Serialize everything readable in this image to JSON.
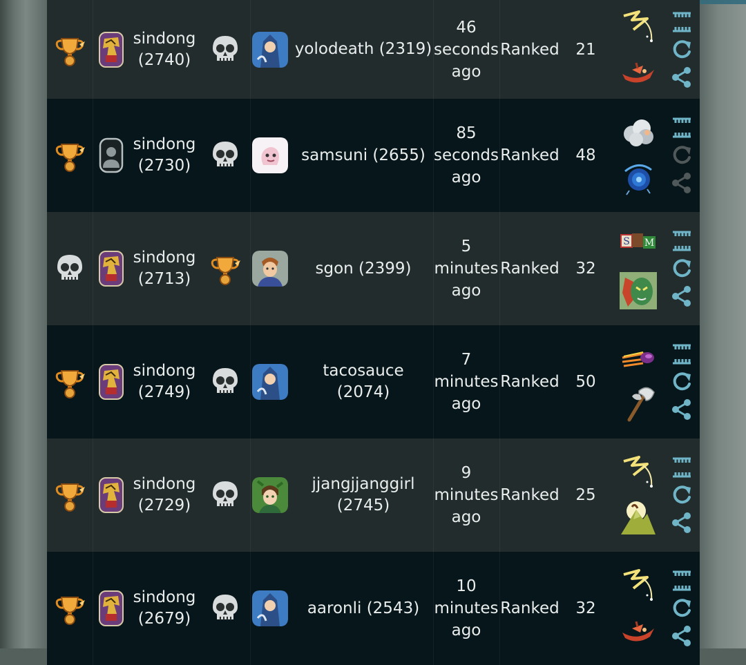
{
  "colors": {
    "row_light": "#222c2d",
    "row_dark": "#07161b",
    "text": "#e9edec",
    "action": "#6fb5c7",
    "action_dim": "#50585a"
  },
  "rows": [
    {
      "p1_result": "trophy-icon",
      "p1_avatar": "armored-knight-avatar",
      "p1_name": "sindong",
      "p1_rating": "(2740)",
      "p2_result": "skull-icon",
      "p2_avatar": "wizard-avatar",
      "p2_name_lines": [
        "yolodeath (2319)"
      ],
      "time_lines": [
        "46",
        "seconds",
        "ago"
      ],
      "type": "Ranked",
      "turns": "21",
      "cards": [
        "lightning-card-icon",
        "boat-card-icon"
      ],
      "replay_enabled": true
    },
    {
      "p1_result": "trophy-icon",
      "p1_avatar": "default-avatar",
      "p1_name": "sindong",
      "p1_rating": "(2730)",
      "p2_result": "skull-icon",
      "p2_avatar": "ghost-pet-avatar",
      "p2_name_lines": [
        "samsuni (2655)"
      ],
      "time_lines": [
        "85",
        "seconds",
        "ago"
      ],
      "type": "Ranked",
      "turns": "48",
      "cards": [
        "cloud-card-icon",
        "vortex-card-icon"
      ],
      "replay_enabled": false
    },
    {
      "p1_result": "skull-icon",
      "p1_avatar": "armored-knight-avatar",
      "p1_name": "sindong",
      "p1_rating": "(2713)",
      "p2_result": "trophy-icon",
      "p2_avatar": "soldier-avatar",
      "p2_name_lines": [
        "sgon (2399)"
      ],
      "time_lines": [
        "5",
        "minutes",
        "ago"
      ],
      "type": "Ranked",
      "turns": "32",
      "cards": [
        "letter-blocks-card-icon",
        "green-face-card-icon"
      ],
      "replay_enabled": true
    },
    {
      "p1_result": "trophy-icon",
      "p1_avatar": "armored-knight-avatar",
      "p1_name": "sindong",
      "p1_rating": "(2749)",
      "p2_result": "skull-icon",
      "p2_avatar": "wizard-avatar",
      "p2_name_lines": [
        "tacosauce (2074)"
      ],
      "time_lines": [
        "7",
        "minutes",
        "ago"
      ],
      "type": "Ranked",
      "turns": "50",
      "cards": [
        "comet-card-icon",
        "axe-card-icon"
      ],
      "replay_enabled": true
    },
    {
      "p1_result": "trophy-icon",
      "p1_avatar": "armored-knight-avatar",
      "p1_name": "sindong",
      "p1_rating": "(2729)",
      "p2_result": "skull-icon",
      "p2_avatar": "elf-avatar",
      "p2_name_lines": [
        "jjangjjanggirl",
        "(2745)"
      ],
      "time_lines": [
        "9",
        "minutes",
        "ago"
      ],
      "type": "Ranked",
      "turns": "25",
      "cards": [
        "lightning-card-icon",
        "mountain-card-icon"
      ],
      "replay_enabled": true
    },
    {
      "p1_result": "trophy-icon",
      "p1_avatar": "armored-knight-avatar",
      "p1_name": "sindong",
      "p1_rating": "(2679)",
      "p2_result": "skull-icon",
      "p2_avatar": "wizard-avatar",
      "p2_name_lines": [
        "aaronli (2543)"
      ],
      "time_lines": [
        "10",
        "minutes",
        "ago"
      ],
      "type": "Ranked",
      "turns": "32",
      "cards": [
        "lightning-card-icon",
        "boat-card-icon"
      ],
      "replay_enabled": true
    }
  ]
}
